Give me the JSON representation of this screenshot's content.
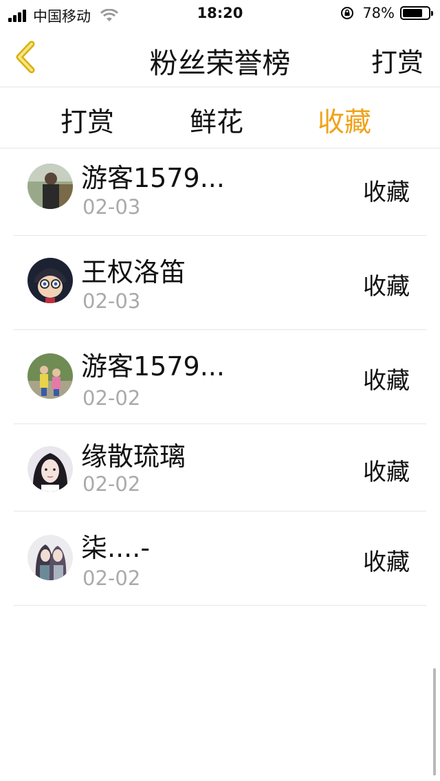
{
  "status_bar": {
    "carrier": "中国移动",
    "time": "18:20",
    "battery_text": "78%",
    "battery_level": 0.78
  },
  "nav": {
    "title": "粉丝荣誉榜",
    "right_label": "打赏"
  },
  "tabs": [
    {
      "label": "打赏",
      "active": false
    },
    {
      "label": "鲜花",
      "active": false
    },
    {
      "label": "收藏",
      "active": true
    }
  ],
  "list": [
    {
      "name": "游客1579...",
      "date": "02-03",
      "action": "收藏",
      "avatar": "avatar-photo-man-outdoors"
    },
    {
      "name": "王权洛笛",
      "date": "02-03",
      "action": "收藏",
      "avatar": "avatar-anime-boy-glasses"
    },
    {
      "name": "游客1579...",
      "date": "02-02",
      "action": "收藏",
      "avatar": "avatar-photo-children"
    },
    {
      "name": "缘散琉璃",
      "date": "02-02",
      "action": "收藏",
      "avatar": "avatar-girl-portrait"
    },
    {
      "name": "柒....-",
      "date": "02-02",
      "action": "收藏",
      "avatar": "avatar-illustrated-couple"
    }
  ],
  "colors": {
    "accent": "#f0a21a",
    "divider": "#e5e5e5",
    "muted_text": "#aaaaaa"
  }
}
